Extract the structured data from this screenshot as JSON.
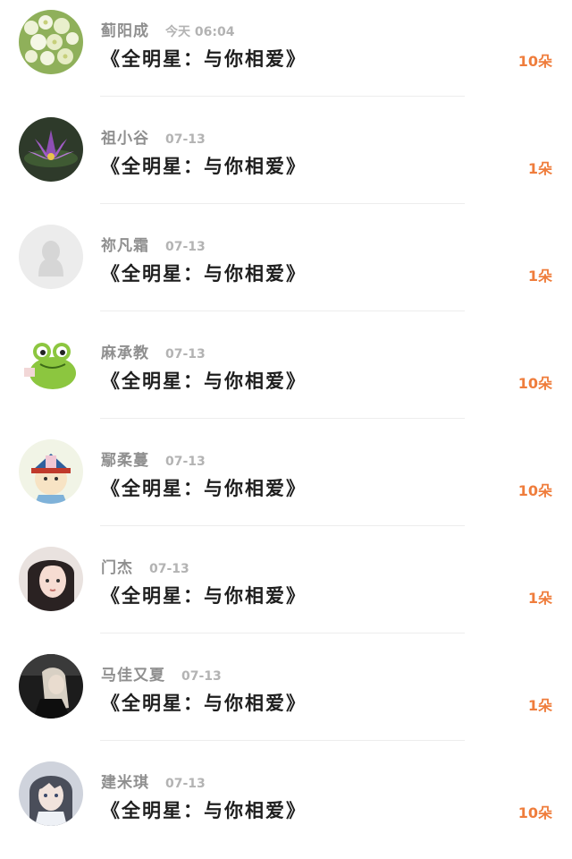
{
  "colors": {
    "name": "#8f8f8f",
    "time": "#b3b3b3",
    "title": "#1e1e1e",
    "gift_count": "#ef7d3c",
    "divider": "#ededed"
  },
  "entries": [
    {
      "name": "蓟阳成",
      "time": "今天 06:04",
      "title": "《全明星：与你相爱》",
      "gift": "10朵",
      "avatar": "white-flowers-avatar"
    },
    {
      "name": "祖小谷",
      "time": "07-13",
      "title": "《全明星：与你相爱》",
      "gift": "1朵",
      "avatar": "purple-lotus-avatar"
    },
    {
      "name": "祢凡霜",
      "time": "07-13",
      "title": "《全明星：与你相爱》",
      "gift": "1朵",
      "avatar": "default-penguin-avatar"
    },
    {
      "name": "麻承教",
      "time": "07-13",
      "title": "《全明星：与你相爱》",
      "gift": "10朵",
      "avatar": "green-frog-avatar"
    },
    {
      "name": "鄢柔蔓",
      "time": "07-13",
      "title": "《全明星：与你相爱》",
      "gift": "10朵",
      "avatar": "cartoon-character-avatar"
    },
    {
      "name": "门杰",
      "time": "07-13",
      "title": "《全明星：与你相爱》",
      "gift": "1朵",
      "avatar": "girl-portrait-avatar"
    },
    {
      "name": "马佳又夏",
      "time": "07-13",
      "title": "《全明星：与你相爱》",
      "gift": "1朵",
      "avatar": "girl-in-car-avatar"
    },
    {
      "name": "建米琪",
      "time": "07-13",
      "title": "《全明星：与你相爱》",
      "gift": "10朵",
      "avatar": "anime-boy-avatar"
    }
  ]
}
